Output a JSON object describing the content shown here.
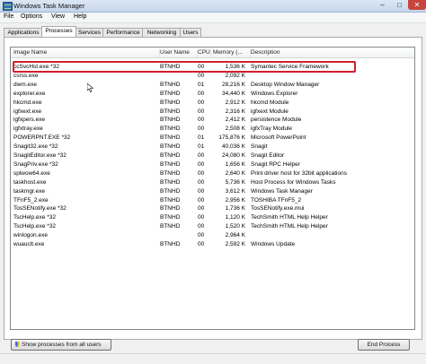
{
  "window": {
    "title": "Windows Task Manager",
    "minimize_glyph": "–",
    "maximize_glyph": "□",
    "close_glyph": "✕"
  },
  "menu": {
    "items": [
      "File",
      "Options",
      "View",
      "Help"
    ]
  },
  "tabs": {
    "items": [
      "Applications",
      "Processes",
      "Services",
      "Performance",
      "Networking",
      "Users"
    ],
    "active": "Processes"
  },
  "table": {
    "headers": {
      "image_name": "Image Name",
      "user_name": "User Name",
      "cpu": "CPU",
      "memory": "Memory (...",
      "description": "Description"
    },
    "sort_glyph": "^",
    "rows": [
      {
        "name": "ccSvcHst.exe *32",
        "user": "BTNHD",
        "cpu": "00",
        "mem": "1,536 K",
        "desc": "Symantec Service Framework"
      },
      {
        "name": "csrss.exe",
        "user": "",
        "cpu": "00",
        "mem": "2,092 K",
        "desc": ""
      },
      {
        "name": "dwm.exe",
        "user": "BTNHD",
        "cpu": "01",
        "mem": "28,216 K",
        "desc": "Desktop Window Manager"
      },
      {
        "name": "explorer.exe",
        "user": "BTNHD",
        "cpu": "00",
        "mem": "34,440 K",
        "desc": "Windows Explorer"
      },
      {
        "name": "hkcmd.exe",
        "user": "BTNHD",
        "cpu": "00",
        "mem": "2,912 K",
        "desc": "hkcmd Module"
      },
      {
        "name": "igfxext.exe",
        "user": "BTNHD",
        "cpu": "00",
        "mem": "2,316 K",
        "desc": "igfxext Module"
      },
      {
        "name": "igfxpers.exe",
        "user": "BTNHD",
        "cpu": "00",
        "mem": "2,412 K",
        "desc": "persistence Module"
      },
      {
        "name": "igfxtray.exe",
        "user": "BTNHD",
        "cpu": "00",
        "mem": "2,508 K",
        "desc": "igfxTray Module"
      },
      {
        "name": "POWERPNT.EXE *32",
        "user": "BTNHD",
        "cpu": "01",
        "mem": "175,876 K",
        "desc": "Microsoft PowerPoint"
      },
      {
        "name": "Snagit32.exe *32",
        "user": "BTNHD",
        "cpu": "01",
        "mem": "40,036 K",
        "desc": "Snagit"
      },
      {
        "name": "SnagitEditor.exe *32",
        "user": "BTNHD",
        "cpu": "00",
        "mem": "24,080 K",
        "desc": "Snagit Editor"
      },
      {
        "name": "SnagPriv.exe *32",
        "user": "BTNHD",
        "cpu": "00",
        "mem": "1,656 K",
        "desc": "Snagit RPC Helper"
      },
      {
        "name": "splwow64.exe",
        "user": "BTNHD",
        "cpu": "00",
        "mem": "2,640 K",
        "desc": "Print driver host for 32bit applications"
      },
      {
        "name": "taskhost.exe",
        "user": "BTNHD",
        "cpu": "00",
        "mem": "5,736 K",
        "desc": "Host Process for Windows Tasks"
      },
      {
        "name": "taskmgr.exe",
        "user": "BTNHD",
        "cpu": "00",
        "mem": "3,612 K",
        "desc": "Windows Task Manager"
      },
      {
        "name": "TFnF5_2.exe",
        "user": "BTNHD",
        "cpu": "00",
        "mem": "2,956 K",
        "desc": "TOSHIBA TFnF5_2"
      },
      {
        "name": "TosSENotify.exe *32",
        "user": "BTNHD",
        "cpu": "00",
        "mem": "1,736 K",
        "desc": "TosSENotify.exe.mui"
      },
      {
        "name": "TscHelp.exe *32",
        "user": "BTNHD",
        "cpu": "00",
        "mem": "1,120 K",
        "desc": "TechSmith HTML Help Helper"
      },
      {
        "name": "TscHelp.exe *32",
        "user": "BTNHD",
        "cpu": "00",
        "mem": "1,520 K",
        "desc": "TechSmith HTML Help Helper"
      },
      {
        "name": "winlogon.exe",
        "user": "",
        "cpu": "00",
        "mem": "2,964 K",
        "desc": ""
      },
      {
        "name": "wuauclt.exe",
        "user": "BTNHD",
        "cpu": "00",
        "mem": "2,592 K",
        "desc": "Windows Update"
      }
    ]
  },
  "buttons": {
    "show_all": "Show processes from all users",
    "end_process": "End Process"
  },
  "colors": {
    "highlight": "#d11f2e",
    "close_button": "#c7463b"
  }
}
